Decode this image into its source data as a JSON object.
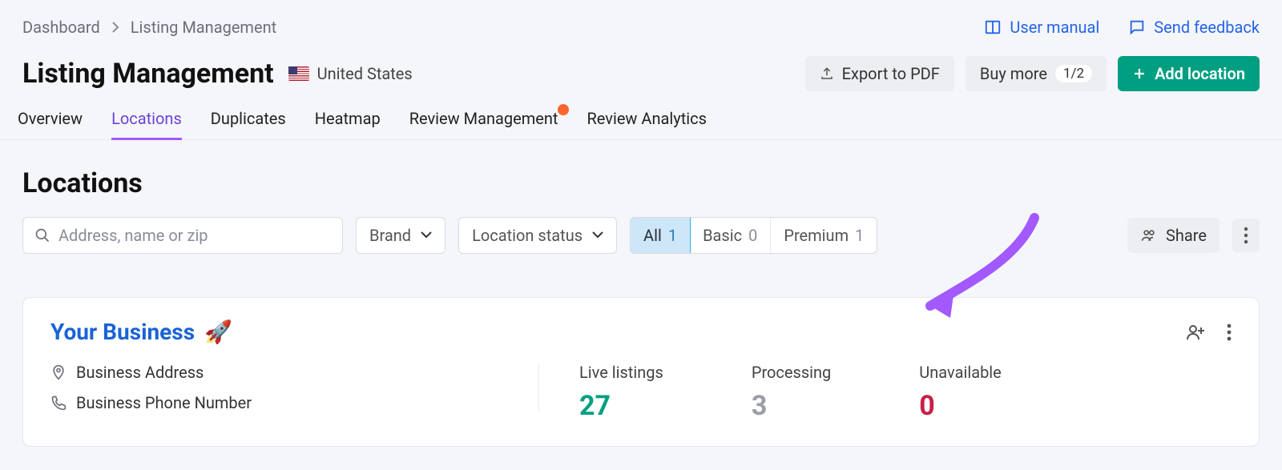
{
  "breadcrumb": {
    "root": "Dashboard",
    "current": "Listing Management"
  },
  "header_links": {
    "manual": "User manual",
    "feedback": "Send feedback"
  },
  "title": "Listing Management",
  "country": "United States",
  "actions": {
    "export": "Export to PDF",
    "buy_more": "Buy more",
    "buy_count": "1/2",
    "add_location": "Add location"
  },
  "tabs": [
    "Overview",
    "Locations",
    "Duplicates",
    "Heatmap",
    "Review Management",
    "Review Analytics"
  ],
  "active_tab": "Locations",
  "section_title": "Locations",
  "search_placeholder": "Address, name or zip",
  "filters": {
    "brand": "Brand",
    "status": "Location status"
  },
  "segments": [
    {
      "label": "All",
      "count": 1
    },
    {
      "label": "Basic",
      "count": 0
    },
    {
      "label": "Premium",
      "count": 1
    }
  ],
  "share": "Share",
  "business": {
    "name": "Your Business",
    "emoji": "🚀",
    "address": "Business Address",
    "phone": "Business Phone Number",
    "stats": {
      "live_label": "Live listings",
      "live": 27,
      "processing_label": "Processing",
      "processing": 3,
      "unavailable_label": "Unavailable",
      "unavailable": 0
    }
  }
}
